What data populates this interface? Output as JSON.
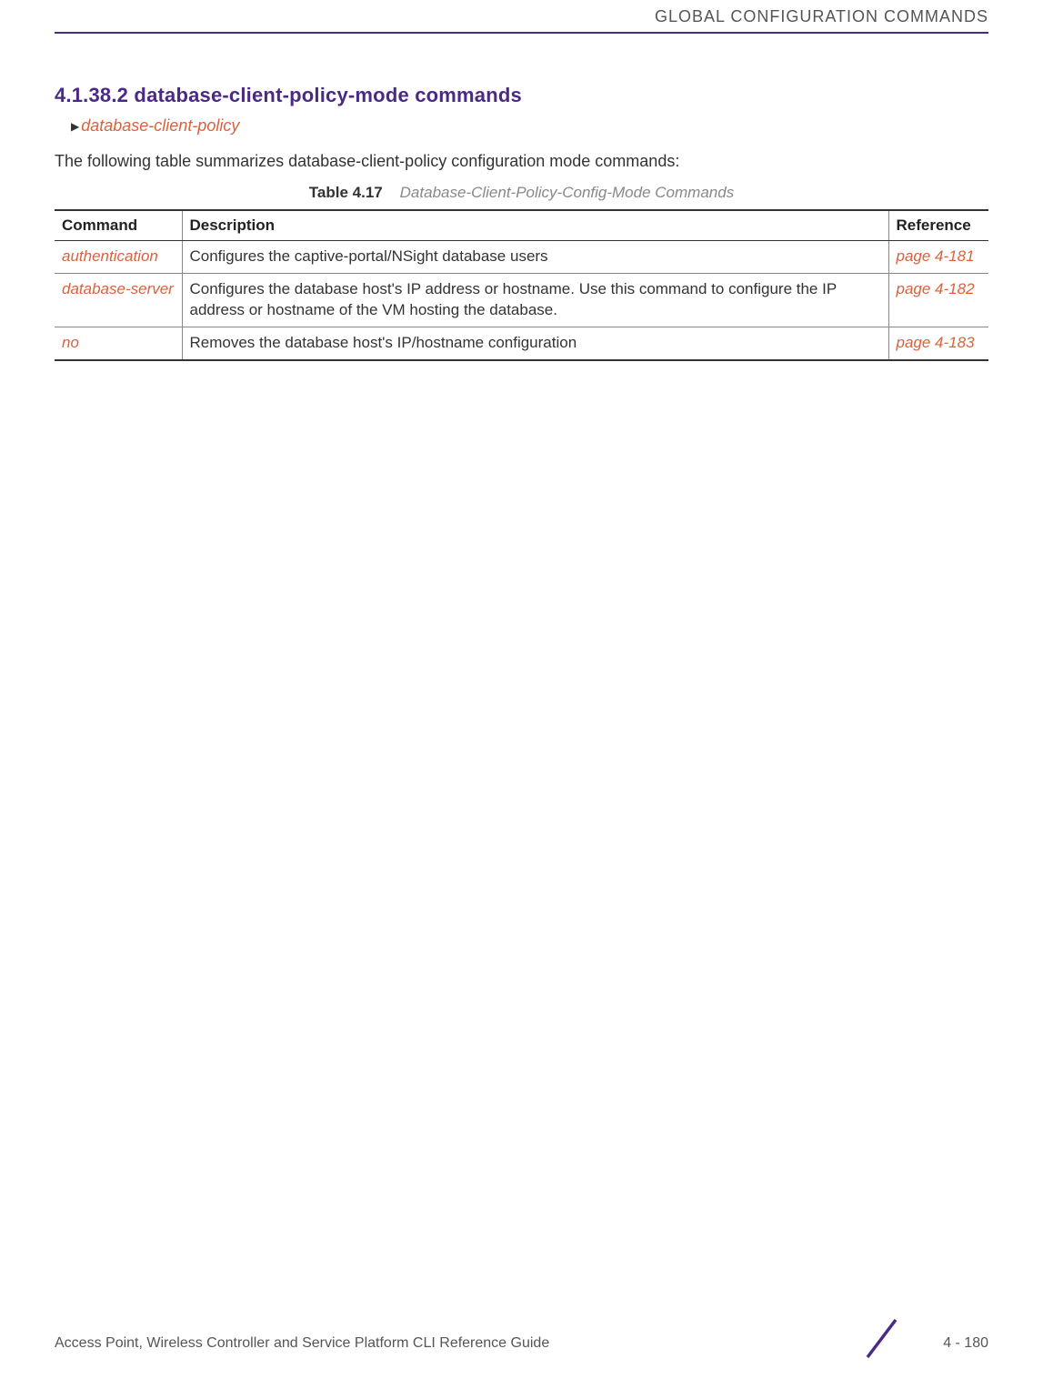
{
  "header": {
    "running_title": "GLOBAL CONFIGURATION COMMANDS"
  },
  "section": {
    "number_title": "4.1.38.2 database-client-policy-mode commands",
    "breadcrumb": "database-client-policy",
    "intro": "The following table summarizes database-client-policy configuration mode commands:",
    "table_label": "Table 4.17",
    "table_title": "Database-Client-Policy-Config-Mode Commands"
  },
  "table": {
    "headers": {
      "command": "Command",
      "description": "Description",
      "reference": "Reference"
    },
    "rows": [
      {
        "command": "authentication",
        "description": "Configures the captive-portal/NSight database users",
        "reference": "page 4-181"
      },
      {
        "command": "database-server",
        "description": "Configures the database host's IP address or hostname. Use this command to configure the IP address or hostname of the VM hosting the database.",
        "reference": "page 4-182"
      },
      {
        "command": "no",
        "description": "Removes the database host's IP/hostname configuration",
        "reference": "page 4-183"
      }
    ]
  },
  "footer": {
    "guide_title": "Access Point, Wireless Controller and Service Platform CLI Reference Guide",
    "page_number": "4 - 180"
  }
}
